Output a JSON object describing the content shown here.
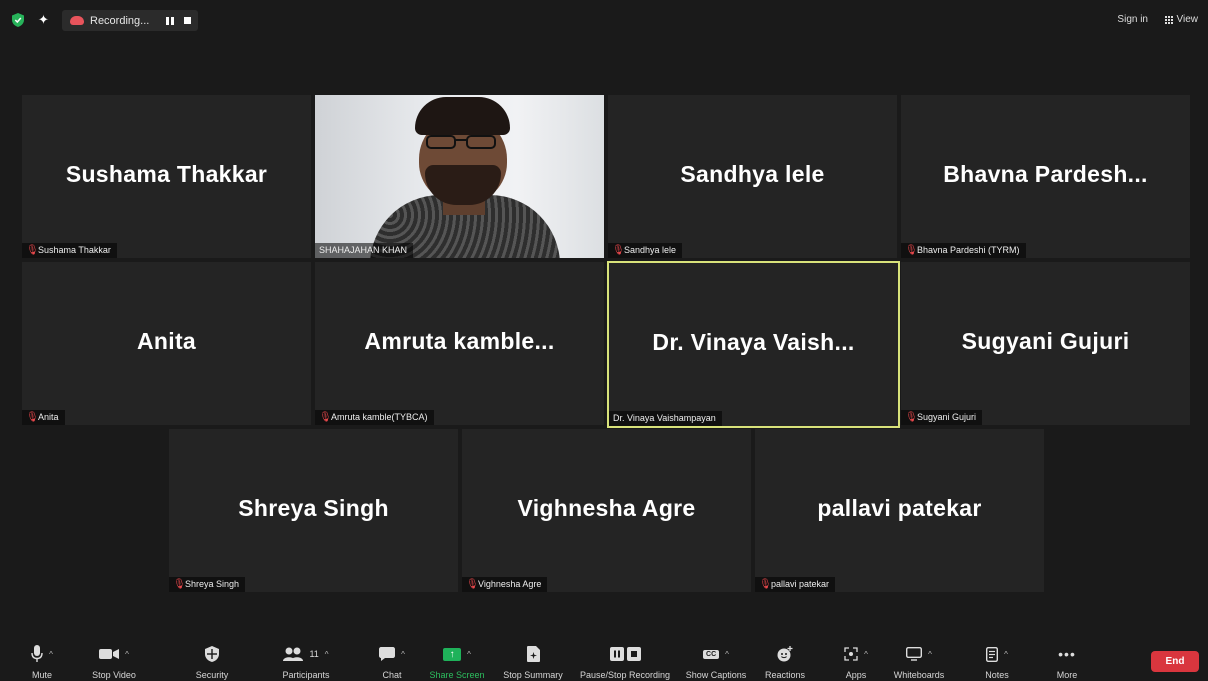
{
  "topbar": {
    "recording_label": "Recording...",
    "signin_label": "Sign in",
    "view_label": "View",
    "colors": {
      "recording_icon": "#e8545c",
      "shield": "#27b35a"
    }
  },
  "participants": [
    {
      "display_name": "Sushama Thakkar",
      "label": "Sushama Thakkar",
      "muted": true
    },
    {
      "display_name": "",
      "label": "SHAHAJAHAN KHAN",
      "muted": false,
      "video_on": true
    },
    {
      "display_name": "Sandhya lele",
      "label": "Sandhya lele",
      "muted": true
    },
    {
      "display_name": "Bhavna  Pardesh...",
      "label": "Bhavna Pardeshi (TYRM)",
      "muted": true
    },
    {
      "display_name": "Anita",
      "label": "Anita",
      "muted": true
    },
    {
      "display_name": "Amruta  kamble...",
      "label": "Amruta kamble(TYBCA)",
      "muted": true
    },
    {
      "display_name": "Dr. Vinaya  Vaish...",
      "label": "Dr. Vinaya Vaishampayan",
      "muted": false,
      "active_speaker": true
    },
    {
      "display_name": "Sugyani Gujuri",
      "label": "Sugyani Gujuri",
      "muted": true
    },
    {
      "display_name": "Shreya Singh",
      "label": "Shreya Singh",
      "muted": true
    },
    {
      "display_name": "Vighnesha Agre",
      "label": "Vighnesha Agre",
      "muted": true
    },
    {
      "display_name": "pallavi patekar",
      "label": "pallavi patekar",
      "muted": true
    }
  ],
  "toolbar": {
    "mute": "Mute",
    "stop_video": "Stop Video",
    "security": "Security",
    "participants": "Participants",
    "participants_count": "11",
    "chat": "Chat",
    "share_screen": "Share Screen",
    "stop_summary": "Stop Summary",
    "pause_stop_recording": "Pause/Stop Recording",
    "show_captions": "Show Captions",
    "reactions": "Reactions",
    "apps": "Apps",
    "whiteboards": "Whiteboards",
    "notes": "Notes",
    "more": "More",
    "end": "End",
    "colors": {
      "share_green": "#1fb25a",
      "end_red": "#d9363e",
      "active_border": "#d8e27a",
      "muted_mic": "#e8474b"
    }
  }
}
